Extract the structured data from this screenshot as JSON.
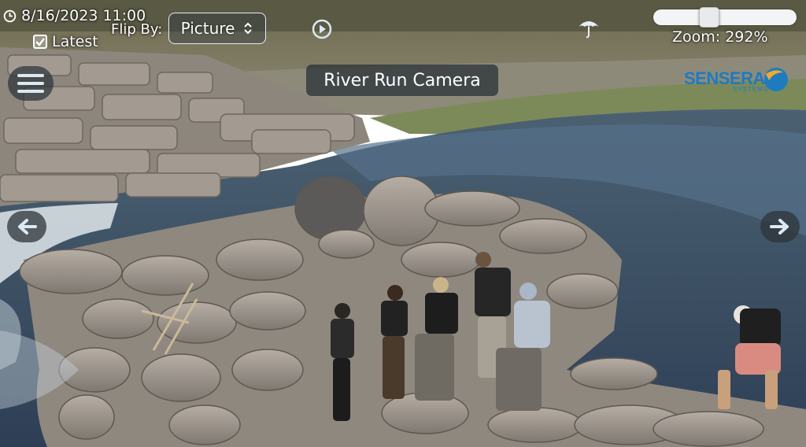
{
  "camera": {
    "timestamp": "8/16/2023 11:00",
    "latest_label": "Latest",
    "latest_checked": true,
    "flip_by_label": "Flip By:",
    "flip_by_value": "Picture",
    "title": "River Run Camera",
    "zoom_label": "Zoom: 292%",
    "zoom_slider_fraction": 0.37
  },
  "brand": {
    "logo_text": "SENSERA",
    "logo_sub": "SYSTEMS",
    "color": "#1e7bbf"
  },
  "icons": {
    "clock": "clock-icon",
    "checkbox": "checkbox-checked-icon",
    "select": "chevron-up-down-icon",
    "play": "play-circle-icon",
    "weather": "umbrella-icon",
    "menu": "hamburger-menu-icon",
    "prev": "arrow-left-icon",
    "next": "arrow-right-icon"
  },
  "colors": {
    "overlay_bg": "#2d343a",
    "icon_accent": "#dbe9f3",
    "water": "#3a4f66",
    "rock": "#9a938b"
  }
}
